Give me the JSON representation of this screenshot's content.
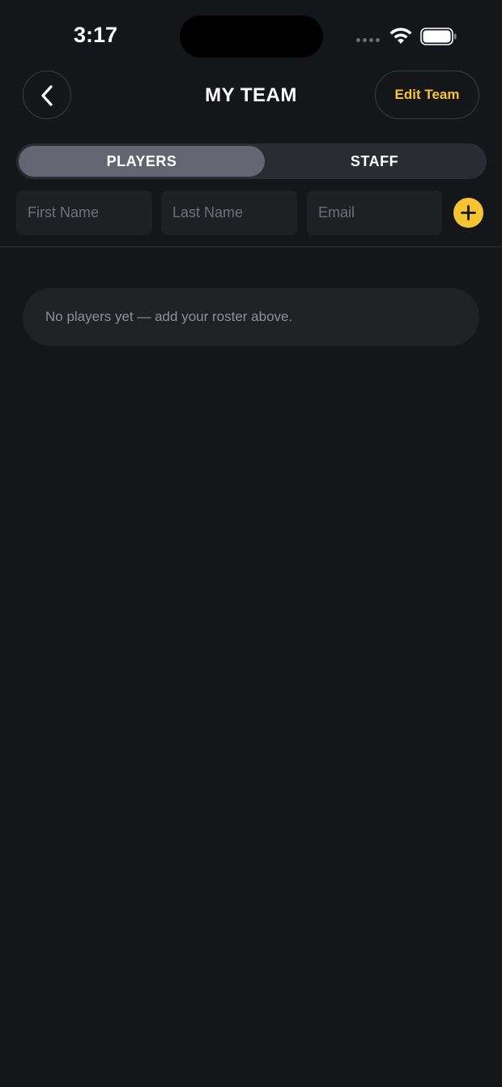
{
  "status_bar": {
    "time": "3:17"
  },
  "header": {
    "title": "MY TEAM",
    "edit_label": "Edit Team",
    "back_icon": "chevron-left-icon"
  },
  "tabs": [
    {
      "label": "PLAYERS",
      "selected": true
    },
    {
      "label": "STAFF",
      "selected": false
    }
  ],
  "form": {
    "first_name_placeholder": "First Name",
    "last_name_placeholder": "Last Name",
    "email_placeholder": "Email",
    "add_icon": "plus-icon"
  },
  "empty_state": {
    "message": "No players yet — add your roster above."
  },
  "colors": {
    "background": "#15161a",
    "accent": "#f5c430",
    "active_tab": "#636570",
    "field_bg": "#1f2024",
    "placeholder": "#6f7177"
  }
}
